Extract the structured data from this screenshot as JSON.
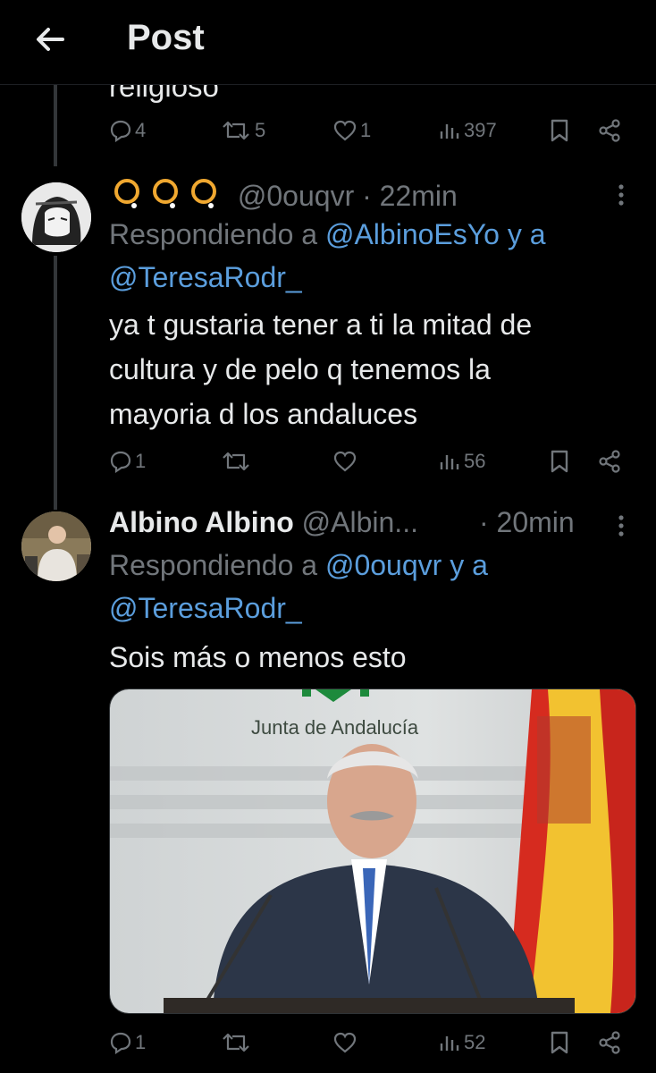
{
  "header": {
    "title": "Post"
  },
  "previous_tweet": {
    "cut_text": "religioso",
    "reply_count": "4",
    "retweet_count": "5",
    "like_count": "1",
    "views": "397"
  },
  "tweets": [
    {
      "display_name": "QQQ",
      "handle": "@0ouqvr",
      "separator": "·",
      "time": "22min",
      "replying_prefix": "Respondiendo a",
      "replying_to_1": "@AlbinoEsYo",
      "replying_join": "y a",
      "replying_to_2": "@TeresaRodr_",
      "text_lines": [
        "ya t gustaria tener a ti la mitad de",
        "cultura y de pelo q tenemos la",
        "mayoria d los andaluces"
      ],
      "reply_count": "1",
      "retweet_count": "",
      "like_count": "",
      "views": "56"
    },
    {
      "display_name": "Albino Albino",
      "handle": "@Albin...",
      "separator": "·",
      "time": "20min",
      "replying_prefix": "Respondiendo a",
      "replying_to_1": "@0ouqvr",
      "replying_join": "y a",
      "replying_to_2": "@TeresaRodr_",
      "text_lines": [
        "Sois más o menos esto"
      ],
      "media_caption": "Junta de Andalucía",
      "reply_count": "1",
      "retweet_count": "",
      "like_count": "",
      "views": "52"
    }
  ],
  "colors": {
    "background": "#000000",
    "text": "#e7e9ea",
    "muted": "#71767b",
    "link": "#5b9edd",
    "name_emoji": "#f0a830"
  }
}
